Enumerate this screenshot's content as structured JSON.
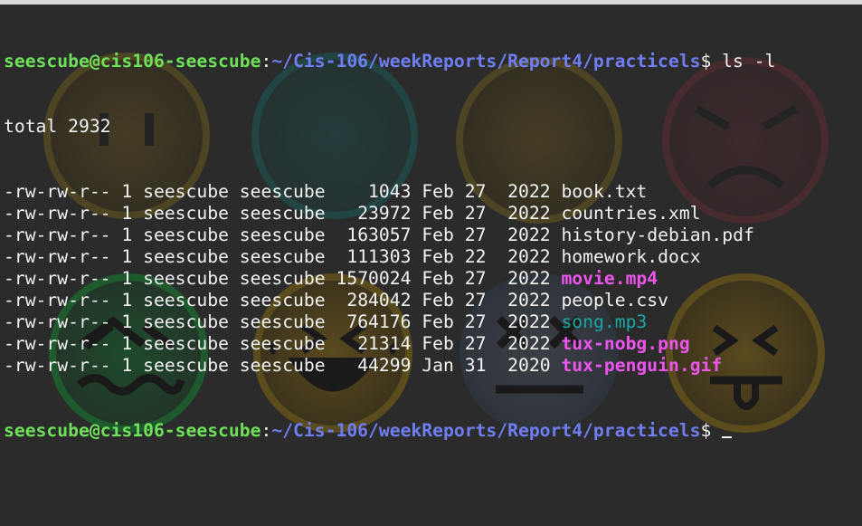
{
  "prompt": {
    "user_host": "seescube@cis106-seescube",
    "colon": ":",
    "path": "~/Cis-106/weekReports/Report4/practicels",
    "dollar": "$"
  },
  "command": " ls -l",
  "total": "total 2932",
  "files": [
    {
      "perms": "-rw-rw-r--",
      "links": "1",
      "owner": "seescube",
      "group": "seescube",
      "size": "   1043",
      "month": "Feb",
      "day": "27",
      "year": " 2022",
      "name": "book.txt",
      "kind": "plain"
    },
    {
      "perms": "-rw-rw-r--",
      "links": "1",
      "owner": "seescube",
      "group": "seescube",
      "size": "  23972",
      "month": "Feb",
      "day": "27",
      "year": " 2022",
      "name": "countries.xml",
      "kind": "plain"
    },
    {
      "perms": "-rw-rw-r--",
      "links": "1",
      "owner": "seescube",
      "group": "seescube",
      "size": " 163057",
      "month": "Feb",
      "day": "27",
      "year": " 2022",
      "name": "history-debian.pdf",
      "kind": "plain"
    },
    {
      "perms": "-rw-rw-r--",
      "links": "1",
      "owner": "seescube",
      "group": "seescube",
      "size": " 111303",
      "month": "Feb",
      "day": "22",
      "year": " 2022",
      "name": "homework.docx",
      "kind": "plain"
    },
    {
      "perms": "-rw-rw-r--",
      "links": "1",
      "owner": "seescube",
      "group": "seescube",
      "size": "1570024",
      "month": "Feb",
      "day": "27",
      "year": " 2022",
      "name": "movie.mp4",
      "kind": "magenta"
    },
    {
      "perms": "-rw-rw-r--",
      "links": "1",
      "owner": "seescube",
      "group": "seescube",
      "size": " 284042",
      "month": "Feb",
      "day": "27",
      "year": " 2022",
      "name": "people.csv",
      "kind": "plain"
    },
    {
      "perms": "-rw-rw-r--",
      "links": "1",
      "owner": "seescube",
      "group": "seescube",
      "size": " 764176",
      "month": "Feb",
      "day": "27",
      "year": " 2022",
      "name": "song.mp3",
      "kind": "cyan"
    },
    {
      "perms": "-rw-rw-r--",
      "links": "1",
      "owner": "seescube",
      "group": "seescube",
      "size": "  21314",
      "month": "Feb",
      "day": "27",
      "year": " 2022",
      "name": "tux-nobg.png",
      "kind": "magenta"
    },
    {
      "perms": "-rw-rw-r--",
      "links": "1",
      "owner": "seescube",
      "group": "seescube",
      "size": "  44299",
      "month": "Jan",
      "day": "31",
      "year": " 2020",
      "name": "tux-penguin.gif",
      "kind": "magenta"
    }
  ],
  "colors": {
    "background": "#2b2b2b",
    "user_host": "#6ee05a",
    "path": "#6f7ef2",
    "text": "#f2f2f2",
    "media_file": "#ee55ee",
    "audio_file": "#1aa6a6"
  },
  "wallpaper_icons": [
    "confounded-face-icon",
    "dizzy-face-icon",
    "expressionless-face-icon",
    "angry-face-icon",
    "worried-face-icon",
    "laughing-face-icon",
    "dead-face-icon",
    "tongue-out-face-icon"
  ]
}
